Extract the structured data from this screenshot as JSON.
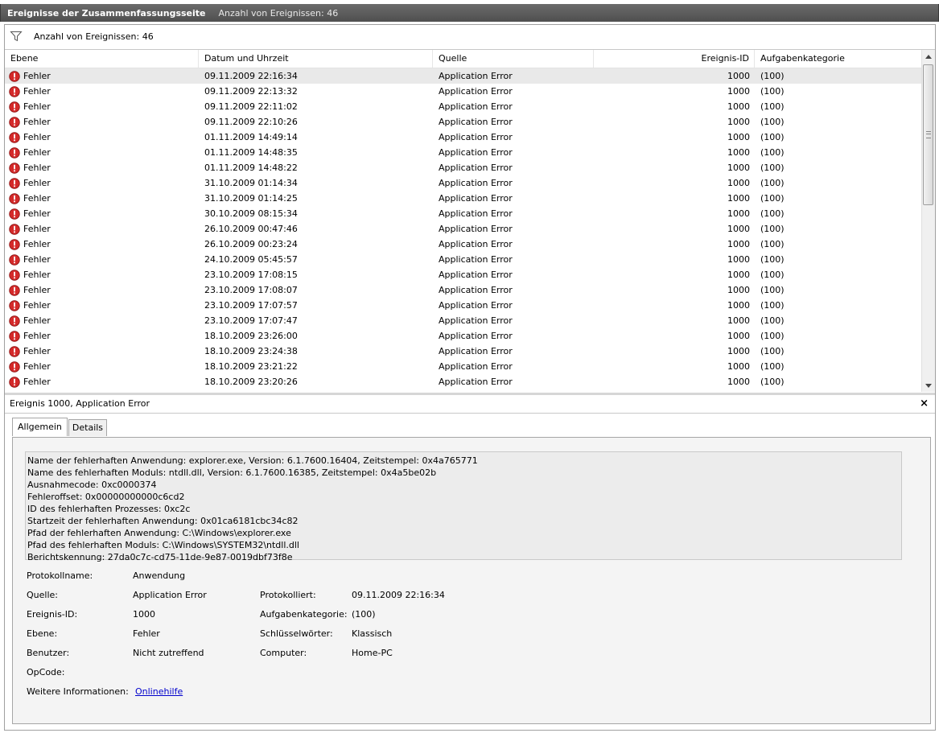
{
  "titlebar": {
    "title": "Ereignisse der Zusammenfassungsseite",
    "count": "Anzahl von Ereignissen: 46"
  },
  "filter": {
    "icon": "filter-icon",
    "label": "Anzahl von Ereignissen: 46"
  },
  "table": {
    "columns": [
      "Ebene",
      "Datum und Uhrzeit",
      "Quelle",
      "Ereignis-ID",
      "Aufgabenkategorie"
    ],
    "rows": [
      {
        "level": "Fehler",
        "date": "09.11.2009 22:16:34",
        "source": "Application Error",
        "id": "1000",
        "category": "(100)"
      },
      {
        "level": "Fehler",
        "date": "09.11.2009 22:13:32",
        "source": "Application Error",
        "id": "1000",
        "category": "(100)"
      },
      {
        "level": "Fehler",
        "date": "09.11.2009 22:11:02",
        "source": "Application Error",
        "id": "1000",
        "category": "(100)"
      },
      {
        "level": "Fehler",
        "date": "09.11.2009 22:10:26",
        "source": "Application Error",
        "id": "1000",
        "category": "(100)"
      },
      {
        "level": "Fehler",
        "date": "01.11.2009 14:49:14",
        "source": "Application Error",
        "id": "1000",
        "category": "(100)"
      },
      {
        "level": "Fehler",
        "date": "01.11.2009 14:48:35",
        "source": "Application Error",
        "id": "1000",
        "category": "(100)"
      },
      {
        "level": "Fehler",
        "date": "01.11.2009 14:48:22",
        "source": "Application Error",
        "id": "1000",
        "category": "(100)"
      },
      {
        "level": "Fehler",
        "date": "31.10.2009 01:14:34",
        "source": "Application Error",
        "id": "1000",
        "category": "(100)"
      },
      {
        "level": "Fehler",
        "date": "31.10.2009 01:14:25",
        "source": "Application Error",
        "id": "1000",
        "category": "(100)"
      },
      {
        "level": "Fehler",
        "date": "30.10.2009 08:15:34",
        "source": "Application Error",
        "id": "1000",
        "category": "(100)"
      },
      {
        "level": "Fehler",
        "date": "26.10.2009 00:47:46",
        "source": "Application Error",
        "id": "1000",
        "category": "(100)"
      },
      {
        "level": "Fehler",
        "date": "26.10.2009 00:23:24",
        "source": "Application Error",
        "id": "1000",
        "category": "(100)"
      },
      {
        "level": "Fehler",
        "date": "24.10.2009 05:45:57",
        "source": "Application Error",
        "id": "1000",
        "category": "(100)"
      },
      {
        "level": "Fehler",
        "date": "23.10.2009 17:08:15",
        "source": "Application Error",
        "id": "1000",
        "category": "(100)"
      },
      {
        "level": "Fehler",
        "date": "23.10.2009 17:08:07",
        "source": "Application Error",
        "id": "1000",
        "category": "(100)"
      },
      {
        "level": "Fehler",
        "date": "23.10.2009 17:07:57",
        "source": "Application Error",
        "id": "1000",
        "category": "(100)"
      },
      {
        "level": "Fehler",
        "date": "23.10.2009 17:07:47",
        "source": "Application Error",
        "id": "1000",
        "category": "(100)"
      },
      {
        "level": "Fehler",
        "date": "18.10.2009 23:26:00",
        "source": "Application Error",
        "id": "1000",
        "category": "(100)"
      },
      {
        "level": "Fehler",
        "date": "18.10.2009 23:24:38",
        "source": "Application Error",
        "id": "1000",
        "category": "(100)"
      },
      {
        "level": "Fehler",
        "date": "18.10.2009 23:21:22",
        "source": "Application Error",
        "id": "1000",
        "category": "(100)"
      },
      {
        "level": "Fehler",
        "date": "18.10.2009 23:20:26",
        "source": "Application Error",
        "id": "1000",
        "category": "(100)"
      }
    ],
    "level_icon": "error-icon",
    "selected_index": 0
  },
  "detail": {
    "header": "Ereignis 1000, Application Error",
    "close_label": "×",
    "tabs": [
      "Allgemein",
      "Details"
    ],
    "active_tab": "Allgemein",
    "description_lines": [
      "Name der fehlerhaften Anwendung: explorer.exe, Version: 6.1.7600.16404, Zeitstempel: 0x4a765771",
      "Name des fehlerhaften Moduls: ntdll.dll, Version: 6.1.7600.16385, Zeitstempel: 0x4a5be02b",
      "Ausnahmecode: 0xc0000374",
      "Fehleroffset: 0x00000000000c6cd2",
      "ID des fehlerhaften Prozesses: 0xc2c",
      "Startzeit der fehlerhaften Anwendung: 0x01ca6181cbc34c82",
      "Pfad der fehlerhaften Anwendung: C:\\Windows\\explorer.exe",
      "Pfad des fehlerhaften Moduls: C:\\Windows\\SYSTEM32\\ntdll.dll",
      "Berichtskennung: 27da0c7c-cd75-11de-9e87-0019dbf73f8e"
    ],
    "props": {
      "protokollname_label": "Protokollname:",
      "protokollname_value": "Anwendung",
      "quelle_label": "Quelle:",
      "quelle_value": "Application Error",
      "protokolliert_label": "Protokolliert:",
      "protokolliert_value": "09.11.2009 22:16:34",
      "ereignis_id_label": "Ereignis-ID:",
      "ereignis_id_value": "1000",
      "aufgabenkategorie_label": "Aufgabenkategorie:",
      "aufgabenkategorie_value": "(100)",
      "ebene_label": "Ebene:",
      "ebene_value": "Fehler",
      "schluesselwoerter_label": "Schlüsselwörter:",
      "schluesselwoerter_value": "Klassisch",
      "benutzer_label": "Benutzer:",
      "benutzer_value": "Nicht zutreffend",
      "computer_label": "Computer:",
      "computer_value": "Home-PC",
      "opcode_label": "OpCode:",
      "weitere_label": "Weitere Informationen:",
      "weitere_link": "Onlinehilfe"
    }
  },
  "colors": {
    "titlebar": "#5a5a5a",
    "selected_row": "#e9e9e9",
    "error_red": "#d42a2a",
    "link": "#0000cc"
  }
}
